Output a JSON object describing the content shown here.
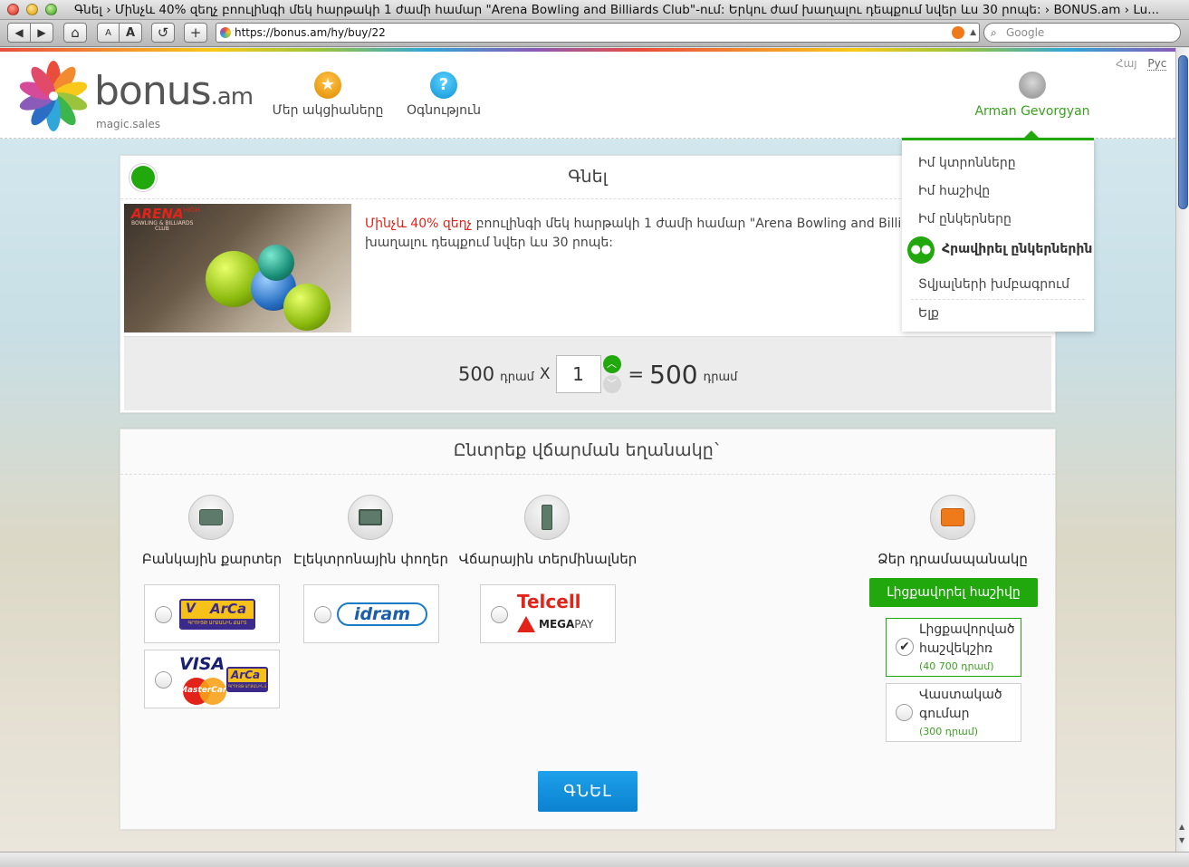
{
  "window": {
    "title": "Գնել › Մինչև 40% զեղչ բոուլինգի մեկ հարթակի 1 ժամի համար \"Arena Bowling and Billiards Club\"-ում: Երկու ժամ խաղալու դեպքում նվեր ևս 30 րոպե: › BONUS.am › Lu..."
  },
  "toolbar": {
    "back": "◀",
    "forward": "▶",
    "home": "⌂",
    "font_small": "A",
    "font_large": "A",
    "reload": "↺",
    "add": "+",
    "url": "https://bonus.am/hy/buy/22",
    "search_placeholder": "Google"
  },
  "header": {
    "logo_text": "bonus",
    "logo_domain": ".am",
    "logo_tagline": "magic.sales",
    "nav": [
      {
        "label": "Մեր ակցիաները",
        "icon": "star-icon"
      },
      {
        "label": "Օգնություն",
        "icon": "help-icon"
      }
    ],
    "languages": [
      "Հայ",
      "Рус"
    ],
    "user_name": "Arman Gevorgyan"
  },
  "dropdown": {
    "items": [
      "Իմ կտրոնները",
      "Իմ հաշիվը",
      "Իմ ընկերները",
      "Հրավիրել ընկերներին",
      "Տվյալների խմբագրում",
      "Ելք"
    ]
  },
  "buy": {
    "title": "Գնել",
    "deal_highlight": "Մինչև 40% զեղչ",
    "deal_line1": " բոուլինգի մեկ հարթակի 1 ժամի համար \"Arena Bowling and Billiards Club",
    "deal_line2": "խաղալու դեպքում նվեր ևս 30 րոպե:",
    "image_logo_main": "ARENA",
    "image_logo_sup": "HIGH",
    "image_logo_sub": "BOWLING & BILLIARDS",
    "image_logo_club": "CLUB",
    "unit_price": "500",
    "currency": "դրամ",
    "times": "X",
    "quantity": "1",
    "equals": "=",
    "total": "500"
  },
  "payment": {
    "title": "Ընտրեք վճարման եղանակը`",
    "methods": [
      {
        "label": "Բանկային քարտեր",
        "icon": "bank-card-icon"
      },
      {
        "label": "Էլեկտրոնային փողեր",
        "icon": "monitor-icon"
      },
      {
        "label": "Վճարային տերմինալներ",
        "icon": "terminal-icon"
      },
      {
        "label": "Ձեր դրամապանակը",
        "icon": "wallet-icon"
      }
    ],
    "arca_v": "V",
    "arca_name": "ArCa",
    "arca_sub": "ԳՐՈՒՅԹ ԱՐՔԱՆԻՆ ՔԱՐՏ",
    "visa": "VISA",
    "mastercard": "MasterCard",
    "idram": "idram",
    "telcell": "Telcell",
    "megapay_mega": "MEGA",
    "megapay_pay": "PAY",
    "topup_button": "Լիցքավորել հաշիվը",
    "wallet_options": [
      {
        "label_1": "Լիցքավորված",
        "label_2": "հաշվեկշիռ",
        "amount": "(40 700 դրամ)",
        "checked": true
      },
      {
        "label_1": "Վաստակած",
        "label_2": "գումար",
        "amount": "(300 դրամ)",
        "checked": false
      }
    ],
    "buy_button": "ԳՆԵԼ"
  },
  "colors": {
    "green": "#21a80d",
    "blue_button": "#0f8fdc",
    "highlight_red": "#e2231a",
    "user_green": "#3aa11f"
  }
}
